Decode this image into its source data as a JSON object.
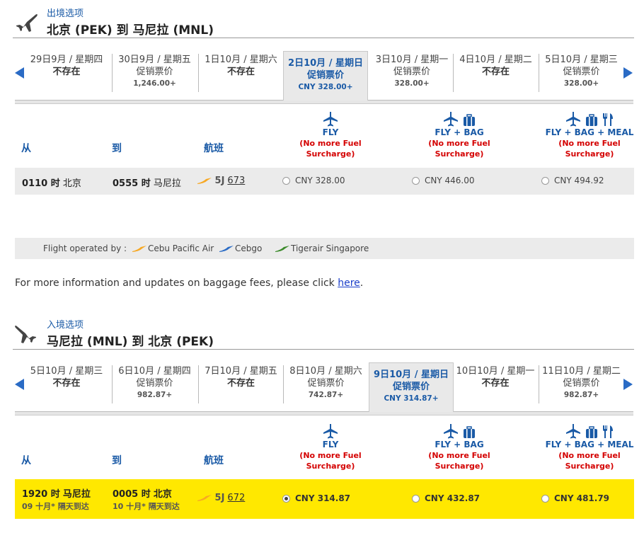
{
  "outbound": {
    "subtitle": "出境选项",
    "title": "北京 (PEK) 到 马尼拉 (MNL)",
    "dates": [
      {
        "date": "29日9月 / 星期四",
        "status": "不存在",
        "price": "",
        "available": false
      },
      {
        "date": "30日9月 / 星期五",
        "status": "促销票价",
        "price": "1,246.00+",
        "available": true
      },
      {
        "date": "1日10月 / 星期六",
        "status": "不存在",
        "price": "",
        "available": false
      },
      {
        "date": "2日10月 / 星期日",
        "status": "促销票价",
        "price": "CNY 328.00+",
        "available": true,
        "selected": true
      },
      {
        "date": "3日10月 / 星期一",
        "status": "促销票价",
        "price": "328.00+",
        "available": true
      },
      {
        "date": "4日10月 / 星期二",
        "status": "不存在",
        "price": "",
        "available": false
      },
      {
        "date": "5日10月 / 星期三",
        "status": "促销票价",
        "price": "328.00+",
        "available": true
      }
    ],
    "headers": {
      "from": "从",
      "to": "到",
      "flight": "航班"
    },
    "fares": [
      {
        "name": "FLY",
        "note1": "(No more Fuel",
        "note2": "Surcharge)"
      },
      {
        "name": "FLY + BAG",
        "note1": "(No more Fuel",
        "note2": "Surcharge)"
      },
      {
        "name": "FLY + BAG + MEAL",
        "note1": "(No more Fuel",
        "note2": "Surcharge)"
      }
    ],
    "row": {
      "dep_time": "0110 时",
      "dep_city": "北京",
      "arr_time": "0555 时",
      "arr_city": "马尼拉",
      "carrier": "5J",
      "flight_no": "673",
      "prices": [
        "CNY 328.00",
        "CNY 446.00",
        "CNY 494.92"
      ],
      "selected_index": -1
    }
  },
  "operated": {
    "label": "Flight operated by :",
    "carriers": [
      {
        "name": "Cebu Pacific Air",
        "color": "#f7a823"
      },
      {
        "name": "Cebgo",
        "color": "#2a6bc5"
      },
      {
        "name": "Tigerair Singapore",
        "color": "#3a8a2a"
      }
    ]
  },
  "baggage": {
    "text": "For more information and updates on baggage fees, please click ",
    "link": "here",
    "suffix": "."
  },
  "inbound": {
    "subtitle": "入境选项",
    "title": "马尼拉 (MNL) 到 北京 (PEK)",
    "dates": [
      {
        "date": "5日10月 / 星期三",
        "status": "不存在",
        "price": "",
        "available": false
      },
      {
        "date": "6日10月 / 星期四",
        "status": "促销票价",
        "price": "982.87+",
        "available": true
      },
      {
        "date": "7日10月 / 星期五",
        "status": "不存在",
        "price": "",
        "available": false
      },
      {
        "date": "8日10月 / 星期六",
        "status": "促销票价",
        "price": "742.87+",
        "available": true
      },
      {
        "date": "9日10月 / 星期日",
        "status": "促销票价",
        "price": "CNY 314.87+",
        "available": true,
        "selected": true
      },
      {
        "date": "10日10月 / 星期一",
        "status": "不存在",
        "price": "",
        "available": false
      },
      {
        "date": "11日10月 / 星期二",
        "status": "促销票价",
        "price": "982.87+",
        "available": true
      }
    ],
    "headers": {
      "from": "从",
      "to": "到",
      "flight": "航班"
    },
    "fares": [
      {
        "name": "FLY",
        "note1": "(No more Fuel",
        "note2": "Surcharge)"
      },
      {
        "name": "FLY + BAG",
        "note1": "(No more Fuel",
        "note2": "Surcharge)"
      },
      {
        "name": "FLY + BAG + MEAL",
        "note1": "(No more Fuel",
        "note2": "Surcharge)"
      }
    ],
    "row": {
      "dep_time": "1920 时",
      "dep_city": "马尼拉",
      "dep_sub": "09 十月*  隔天到达",
      "arr_time": "0005 时",
      "arr_city": "北京",
      "arr_sub": "10 十月*  隔天到达",
      "carrier": "5J",
      "flight_no": "672",
      "prices": [
        "CNY 314.87",
        "CNY 432.87",
        "CNY 481.79"
      ],
      "selected_index": 0
    }
  },
  "colors": {
    "accent": "#1a5aa6",
    "arrow": "#2a6bc5",
    "warning": "#d40000",
    "highlight": "#ffe800"
  }
}
